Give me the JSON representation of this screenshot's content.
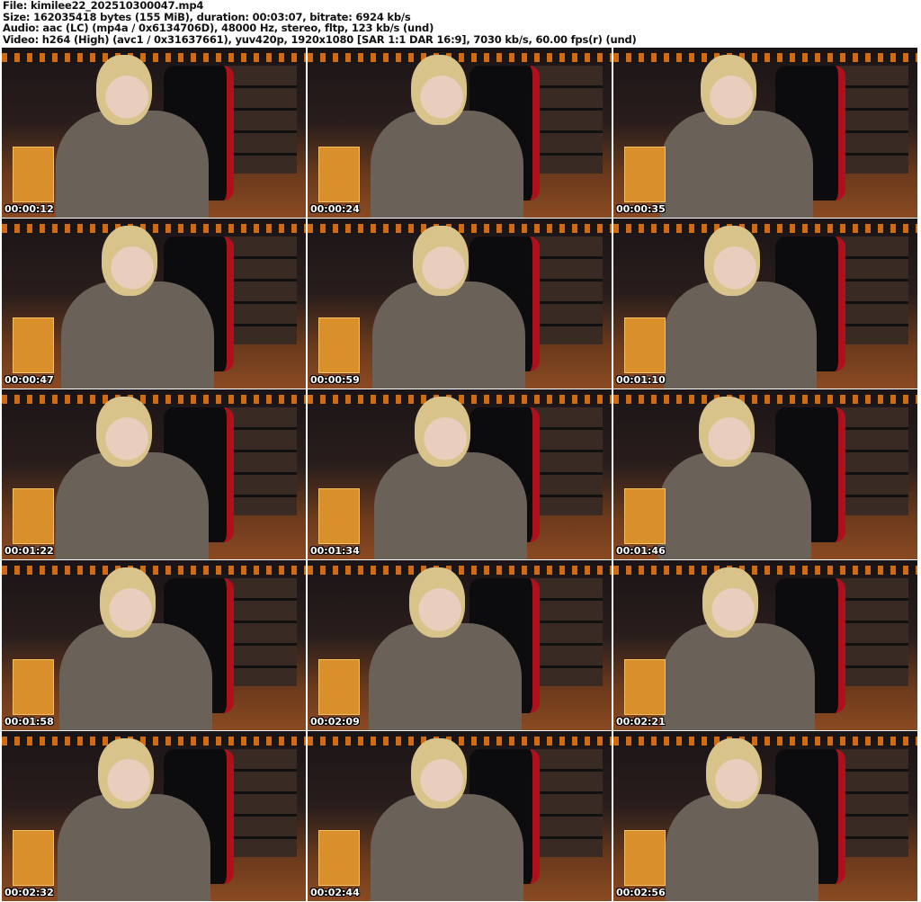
{
  "header": {
    "file": "File: kimilee22_202510300047.mp4",
    "size": "Size: 162035418 bytes (155 MiB), duration: 00:03:07, bitrate: 6924 kb/s",
    "audio": "Audio: aac (LC) (mp4a / 0x6134706D), 48000 Hz, stereo, fltp, 123 kb/s (und)",
    "video": "Video: h264 (High) (avc1 / 0x31637661), yuv420p, 1920x1080 [SAR 1:1 DAR 16:9], 7030 kb/s, 60.00 fps(r) (und)"
  },
  "thumbnails": [
    {
      "timestamp": "00:00:12"
    },
    {
      "timestamp": "00:00:24"
    },
    {
      "timestamp": "00:00:35"
    },
    {
      "timestamp": "00:00:47"
    },
    {
      "timestamp": "00:00:59"
    },
    {
      "timestamp": "00:01:10"
    },
    {
      "timestamp": "00:01:22"
    },
    {
      "timestamp": "00:01:34"
    },
    {
      "timestamp": "00:01:46"
    },
    {
      "timestamp": "00:01:58"
    },
    {
      "timestamp": "00:02:09"
    },
    {
      "timestamp": "00:02:21"
    },
    {
      "timestamp": "00:02:32"
    },
    {
      "timestamp": "00:02:44"
    },
    {
      "timestamp": "00:02:56"
    }
  ]
}
